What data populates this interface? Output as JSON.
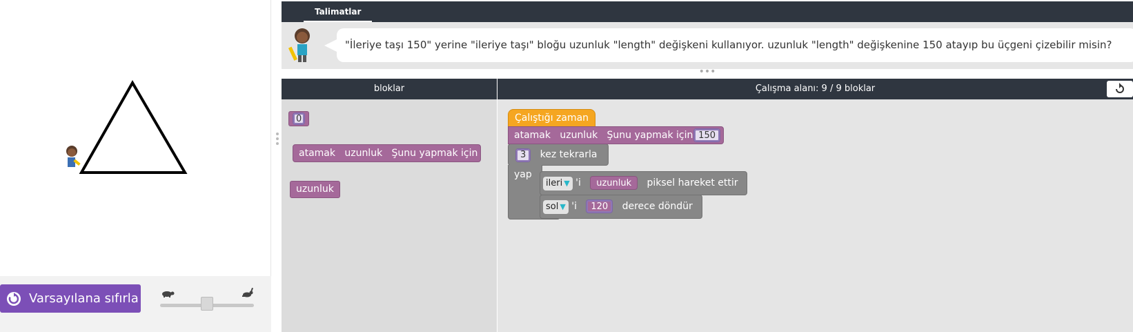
{
  "instructions": {
    "tab_label": "Talimatlar",
    "text": "\"İleriye taşı 150\" yerine \"ileriye taşı\" bloğu uzunluk \"length\" değişkeni kullanıyor. uzunluk \"length\" değişkenine 150 atayıp bu üçgeni çizebilir misin?"
  },
  "controls": {
    "reset_label": "Varsayılana sıfırla",
    "speed_slider_value": 0.5
  },
  "headers": {
    "toolbox": "bloklar",
    "workspace": "Çalışma alanı: 9 / 9 bloklar"
  },
  "toolbox": {
    "number_value": "0",
    "set_block": {
      "kw": "atamak",
      "var": "uzunluk",
      "suffix": "Şunu yapmak için"
    },
    "var_block": "uzunluk"
  },
  "workspace": {
    "event": "Çalıştığı zaman",
    "set_block": {
      "kw": "atamak",
      "var": "uzunluk",
      "suffix": "Şunu yapmak için",
      "value": "150"
    },
    "repeat": {
      "count": "3",
      "label": "kez tekrarla",
      "do": "yap"
    },
    "move": {
      "dir": "ileri",
      "apos": "'i",
      "var": "uzunluk",
      "suffix": "piksel hareket ettir"
    },
    "turn": {
      "dir": "sol",
      "apos": "'i",
      "value": "120",
      "suffix": "derece döndür"
    }
  },
  "colors": {
    "header_dark": "#2f3640",
    "reset_purple": "#7c4fb7",
    "variable_purple": "#a5699a",
    "event_orange": "#f5a621",
    "control_gray": "#878787"
  }
}
